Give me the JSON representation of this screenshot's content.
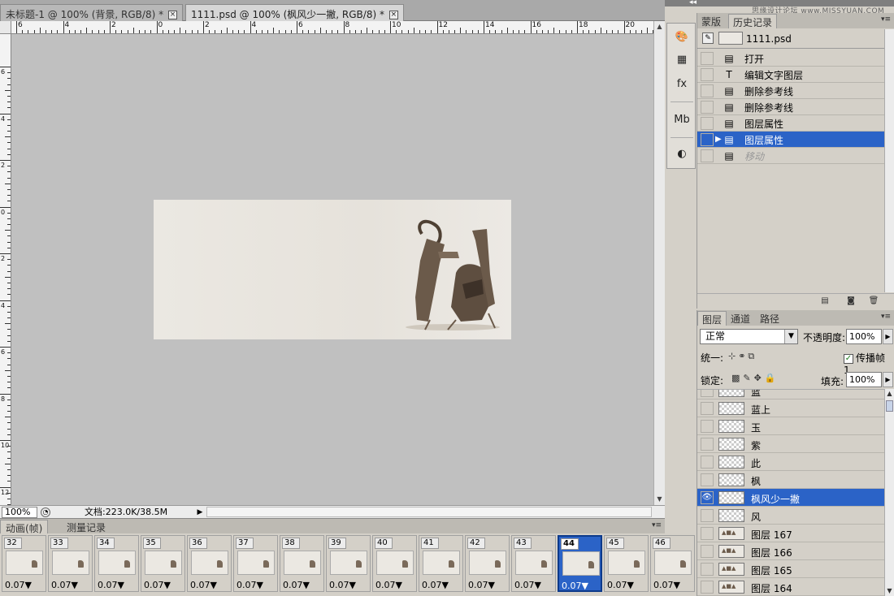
{
  "document_tabs": [
    {
      "title": "未标题-1 @ 100% (背景, RGB/8) *",
      "active": false
    },
    {
      "title": "1111.psd @ 100% (枫风少一撇, RGB/8) *",
      "active": true
    }
  ],
  "ruler_h_labels": [
    "6",
    "4",
    "2",
    "0",
    "2",
    "4",
    "6",
    "8",
    "10",
    "12",
    "14",
    "16",
    "18",
    "20"
  ],
  "ruler_v_labels": [
    "6",
    "4",
    "2",
    "0",
    "2",
    "4",
    "6",
    "8",
    "10",
    "12"
  ],
  "status": {
    "zoom": "100%",
    "doc_info": "文档:223.0K/38.5M"
  },
  "animation_panel": {
    "tabs": [
      "动画(帧)",
      "测量记录"
    ],
    "frames": [
      {
        "num": "32",
        "delay": "0.07▼"
      },
      {
        "num": "33",
        "delay": "0.07▼"
      },
      {
        "num": "34",
        "delay": "0.07▼"
      },
      {
        "num": "35",
        "delay": "0.07▼"
      },
      {
        "num": "36",
        "delay": "0.07▼"
      },
      {
        "num": "37",
        "delay": "0.07▼"
      },
      {
        "num": "38",
        "delay": "0.07▼"
      },
      {
        "num": "39",
        "delay": "0.07▼"
      },
      {
        "num": "40",
        "delay": "0.07▼"
      },
      {
        "num": "41",
        "delay": "0.07▼"
      },
      {
        "num": "42",
        "delay": "0.07▼"
      },
      {
        "num": "43",
        "delay": "0.07▼"
      },
      {
        "num": "44",
        "delay": "0.07▼",
        "selected": true
      },
      {
        "num": "45",
        "delay": "0.07▼"
      },
      {
        "num": "46",
        "delay": "0.07▼"
      }
    ]
  },
  "watermark": "思缘设计论坛 www.MISSYUAN.COM",
  "history_panel": {
    "tabs": [
      "蒙版",
      "历史记录"
    ],
    "snapshot_name": "1111.psd",
    "items": [
      {
        "label": "打开",
        "icon": "document-icon"
      },
      {
        "label": "编辑文字图层",
        "icon": "text-tool-icon"
      },
      {
        "label": "删除参考线",
        "icon": "document-icon"
      },
      {
        "label": "删除参考线",
        "icon": "document-icon"
      },
      {
        "label": "图层属性",
        "icon": "document-icon"
      },
      {
        "label": "图层属性",
        "icon": "document-icon",
        "selected": true
      },
      {
        "label": "移动",
        "icon": "document-icon",
        "ghost": true
      }
    ]
  },
  "layers_panel": {
    "tabs": [
      "图层",
      "通道",
      "路径"
    ],
    "blend_mode": "正常",
    "opacity_label": "不透明度:",
    "opacity": "100%",
    "unify_label": "统一:",
    "propagate_label": "传播帧 1",
    "lock_label": "锁定:",
    "fill_label": "填充:",
    "fill": "100%",
    "layers": [
      {
        "name": "蓝",
        "thumb": "transparent"
      },
      {
        "name": "蓝上",
        "thumb": "transparent"
      },
      {
        "name": "玉",
        "thumb": "transparent"
      },
      {
        "name": "紫",
        "thumb": "transparent"
      },
      {
        "name": "此",
        "thumb": "transparent"
      },
      {
        "name": "枫",
        "thumb": "transparent"
      },
      {
        "name": "枫风少一撇",
        "thumb": "transparent",
        "selected": true,
        "visible": true
      },
      {
        "name": "风",
        "thumb": "transparent"
      },
      {
        "name": "图层 167",
        "thumb": "image"
      },
      {
        "name": "图层 166",
        "thumb": "image"
      },
      {
        "name": "图层 165",
        "thumb": "image"
      },
      {
        "name": "图层 164",
        "thumb": "image"
      }
    ]
  },
  "colors": {
    "selection": "#2b63c7",
    "canvas_bg": "#c0c0c0",
    "artwork_ink": "#6b5a4a"
  }
}
